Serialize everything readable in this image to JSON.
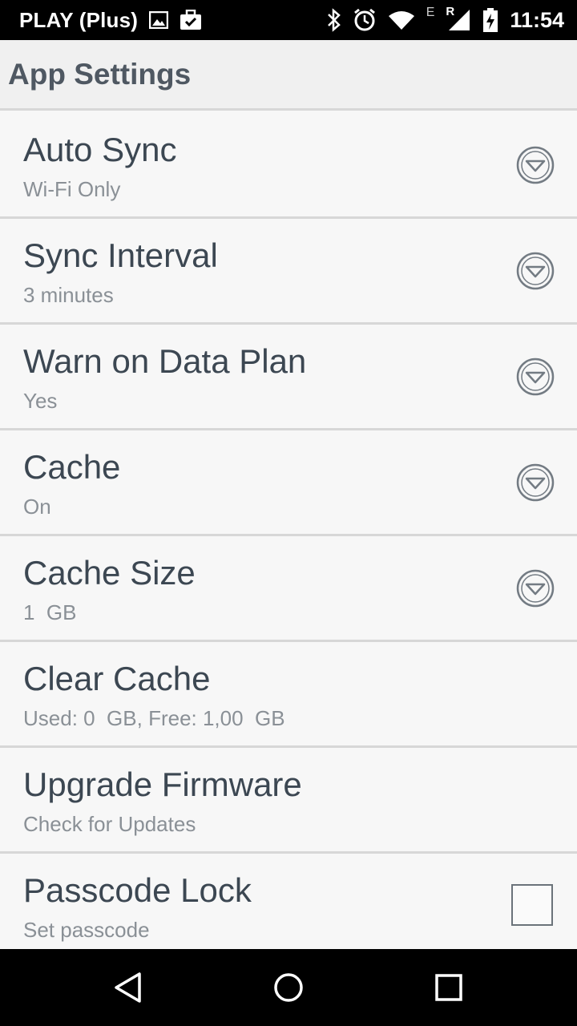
{
  "status_bar": {
    "carrier": "PLAY (Plus)",
    "time": "11:54",
    "icons": [
      "image-icon",
      "briefcase-check-icon",
      "bluetooth-icon",
      "alarm-icon",
      "wifi-icon",
      "signal-e-icon",
      "signal-r-icon",
      "battery-icon"
    ],
    "network_e": "E",
    "network_r": "R"
  },
  "header": {
    "title": "App Settings"
  },
  "settings": [
    {
      "title": "Auto Sync",
      "subtitle": "Wi-Fi Only",
      "control": "dropdown"
    },
    {
      "title": "Sync Interval",
      "subtitle": "3 minutes",
      "control": "dropdown"
    },
    {
      "title": "Warn on Data Plan",
      "subtitle": "Yes",
      "control": "dropdown"
    },
    {
      "title": "Cache",
      "subtitle": "On",
      "control": "dropdown"
    },
    {
      "title": "Cache Size",
      "subtitle": "1  GB",
      "control": "dropdown"
    },
    {
      "title": "Clear Cache",
      "subtitle": "Used: 0  GB, Free: 1,00  GB",
      "control": "none"
    },
    {
      "title": "Upgrade Firmware",
      "subtitle": "Check for Updates",
      "control": "none"
    },
    {
      "title": "Passcode Lock",
      "subtitle": "Set passcode",
      "control": "checkbox",
      "checked": false
    }
  ],
  "nav_bar": {
    "icons": [
      "back-icon",
      "home-icon",
      "recents-icon"
    ]
  },
  "colors": {
    "status_bar_bg": "#000000",
    "header_bg": "#f0f0f0",
    "list_bg": "#f7f7f7",
    "divider": "#d7d7d7",
    "title_text": "#3c4752",
    "subtitle_text": "#8a9096",
    "header_text": "#4f5862"
  }
}
